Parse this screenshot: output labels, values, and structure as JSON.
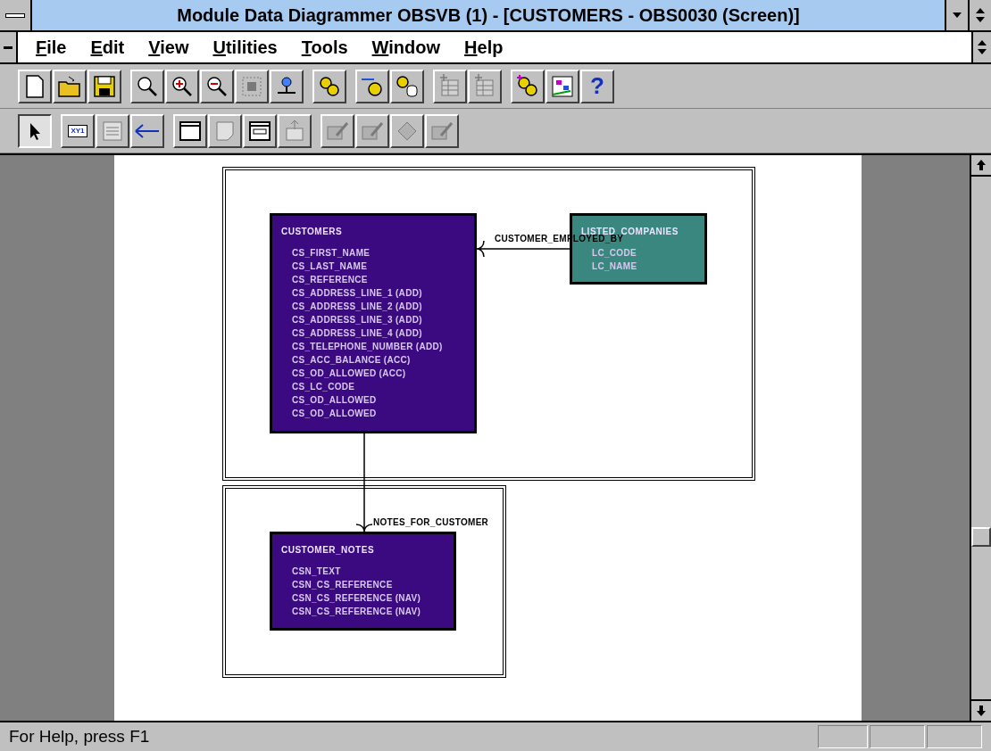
{
  "window": {
    "title": "Module Data Diagrammer OBSVB (1) - [CUSTOMERS - OBS0030 (Screen)]"
  },
  "menu": [
    {
      "label": "File"
    },
    {
      "label": "Edit"
    },
    {
      "label": "View"
    },
    {
      "label": "Utilities"
    },
    {
      "label": "Tools"
    },
    {
      "label": "Window"
    },
    {
      "label": "Help"
    }
  ],
  "toolbar_1": [
    [
      {
        "disabled": false
      },
      {
        "disabled": false
      },
      {
        "disabled": false
      }
    ],
    [
      {
        "disabled": false
      },
      {
        "disabled": false
      },
      {
        "disabled": false
      },
      {
        "disabled": true
      },
      {
        "disabled": false
      }
    ],
    [
      {
        "disabled": false
      }
    ],
    [
      {
        "disabled": false
      },
      {
        "disabled": false
      }
    ],
    [
      {
        "disabled": true
      },
      {
        "disabled": true
      }
    ],
    [
      {
        "disabled": false
      },
      {
        "disabled": false
      },
      {
        "disabled": false,
        "label": "?"
      }
    ]
  ],
  "toolbar_2": [
    [
      {
        "disabled": false,
        "selected": true
      }
    ],
    [
      {
        "disabled": false,
        "selected": false,
        "label": "XY1"
      },
      {
        "disabled": true,
        "selected": false
      },
      {
        "disabled": false,
        "selected": false
      }
    ],
    [
      {
        "disabled": false,
        "selected": false
      },
      {
        "disabled": true,
        "selected": false
      },
      {
        "disabled": false,
        "selected": false
      },
      {
        "disabled": true,
        "selected": false
      }
    ],
    [
      {
        "disabled": true,
        "selected": false
      },
      {
        "disabled": true,
        "selected": false
      },
      {
        "disabled": true,
        "selected": false
      },
      {
        "disabled": true,
        "selected": false
      }
    ]
  ],
  "diagram": {
    "entities": [
      {
        "name": "CUSTOMERS",
        "color": "#3c0a80",
        "attributes": [
          "CS_FIRST_NAME",
          "CS_LAST_NAME",
          "CS_REFERENCE",
          "CS_ADDRESS_LINE_1 (ADD)",
          "CS_ADDRESS_LINE_2 (ADD)",
          "CS_ADDRESS_LINE_3 (ADD)",
          "CS_ADDRESS_LINE_4 (ADD)",
          "CS_TELEPHONE_NUMBER (ADD)",
          "CS_ACC_BALANCE (ACC)",
          "CS_OD_ALLOWED (ACC)",
          "CS_LC_CODE",
          "CS_OD_ALLOWED",
          "CS_OD_ALLOWED"
        ]
      },
      {
        "name": "LISTED_COMPANIES",
        "color": "#3a8780",
        "attributes": [
          "LC_CODE",
          "LC_NAME"
        ]
      },
      {
        "name": "CUSTOMER_NOTES",
        "color": "#3c0a80",
        "attributes": [
          "CSN_TEXT",
          "CSN_CS_REFERENCE",
          "CSN_CS_REFERENCE (NAV)",
          "CSN_CS_REFERENCE (NAV)"
        ]
      }
    ],
    "relationships": [
      {
        "name": "CUSTOMER_EMPLOYED_BY"
      },
      {
        "name": "NOTES_FOR_CUSTOMER"
      }
    ]
  },
  "status_bar": {
    "text": "For Help, press F1"
  }
}
